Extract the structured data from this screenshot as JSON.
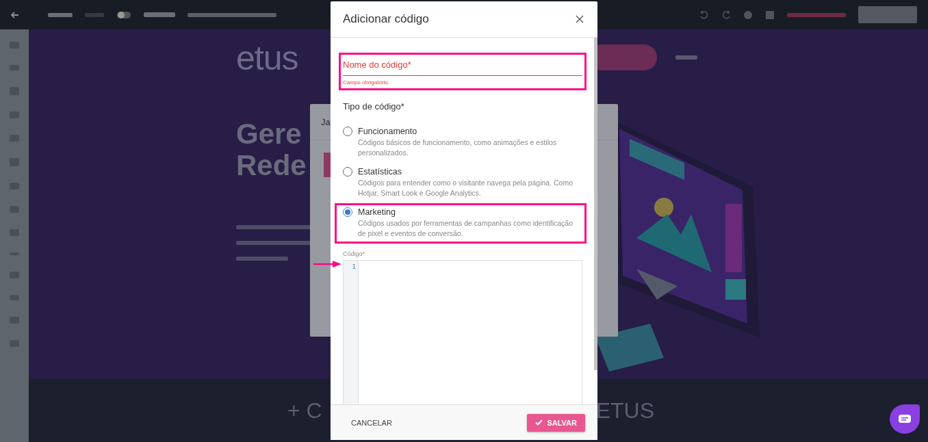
{
  "background": {
    "logo": "etus",
    "headline": [
      "Gere",
      "Rede"
    ],
    "behind_dialog_title": "Ja",
    "footer_texts": [
      "+ C",
      "ETUS"
    ]
  },
  "dialog": {
    "title": "Adicionar código",
    "name_field": {
      "label": "Nome do código*",
      "error": true,
      "helper": "Campo obrigatório.",
      "highlighted": true
    },
    "type_label": "Tipo de código*",
    "options": [
      {
        "label": "Funcionamento",
        "description": "Códigos básicos de funcionamento, como animações e estilos personalizados.",
        "selected": false,
        "highlighted": false
      },
      {
        "label": "Estatísticas",
        "description": "Códigos para entender como o visitante navega pela página. Como Hotjar, Smart Look e Google Analytics.",
        "selected": false,
        "highlighted": false
      },
      {
        "label": "Marketing",
        "description": "Códigos usados por ferramentas de campanhas como identificação de pixel e eventos de conversão.",
        "selected": true,
        "highlighted": true
      }
    ],
    "code_label": "Código*",
    "line_numbers": [
      "1"
    ],
    "buttons": [
      {
        "kind": "text",
        "label": "CANCELAR"
      },
      {
        "kind": "primary",
        "label": "SALVAR"
      }
    ]
  }
}
